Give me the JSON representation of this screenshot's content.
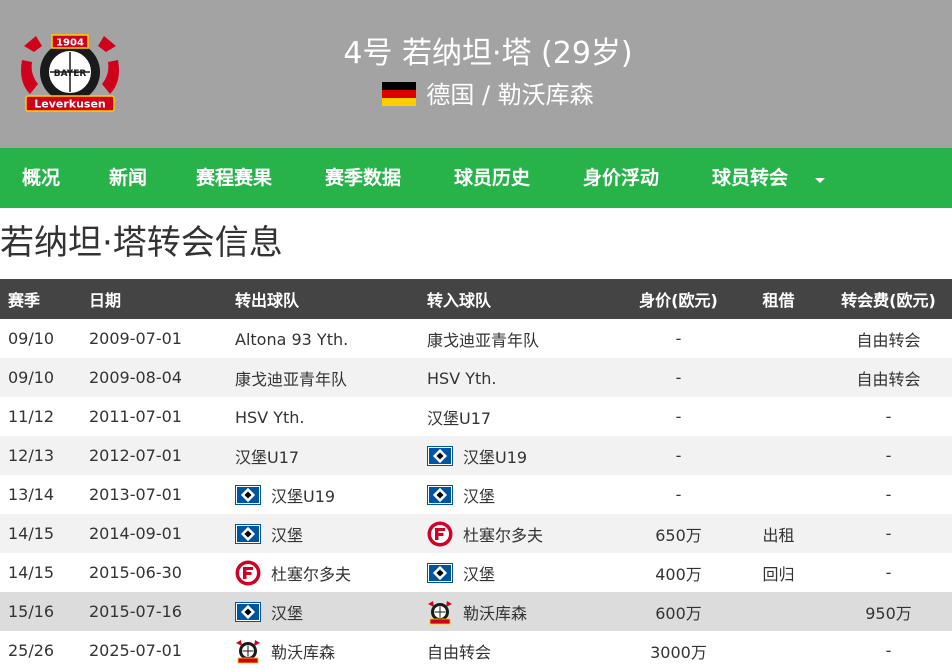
{
  "header": {
    "player_title": "4号 若纳坦·塔 (29岁)",
    "nationality_club": "德国 / 勒沃库森",
    "background_color": "#a3a3a3",
    "logo_text": {
      "year": "1904",
      "brand": "BAYER",
      "city": "Leverkusen"
    }
  },
  "nav": {
    "items": [
      "概况",
      "新闻",
      "赛程赛果",
      "赛季数据",
      "球员历史",
      "身价浮动",
      "球员转会"
    ],
    "color": "#28b34a"
  },
  "page_title": "若纳坦·塔转会信息",
  "table": {
    "headers": [
      "赛季",
      "日期",
      "转出球队",
      "转入球队",
      "身价(欧元)",
      "租借",
      "转会费(欧元)"
    ],
    "rows": [
      {
        "season": "09/10",
        "date": "2009-07-01",
        "from": "Altona 93 Yth.",
        "from_icon": "",
        "to": "康戈迪亚青年队",
        "to_icon": "",
        "value": "-",
        "loan": "",
        "fee": "自由转会"
      },
      {
        "season": "09/10",
        "date": "2009-08-04",
        "from": "康戈迪亚青年队",
        "from_icon": "",
        "to": "HSV Yth.",
        "to_icon": "",
        "value": "-",
        "loan": "",
        "fee": "自由转会"
      },
      {
        "season": "11/12",
        "date": "2011-07-01",
        "from": "HSV Yth.",
        "from_icon": "",
        "to": "汉堡U17",
        "to_icon": "",
        "value": "-",
        "loan": "",
        "fee": "-"
      },
      {
        "season": "12/13",
        "date": "2012-07-01",
        "from": "汉堡U17",
        "from_icon": "",
        "to": "汉堡U19",
        "to_icon": "hsv-crest-icon",
        "value": "-",
        "loan": "",
        "fee": "-"
      },
      {
        "season": "13/14",
        "date": "2013-07-01",
        "from": "汉堡U19",
        "from_icon": "hsv-crest-icon",
        "to": "汉堡",
        "to_icon": "hsv-crest-icon",
        "value": "-",
        "loan": "",
        "fee": "-"
      },
      {
        "season": "14/15",
        "date": "2014-09-01",
        "from": "汉堡",
        "from_icon": "hsv-crest-icon",
        "to": "杜塞尔多夫",
        "to_icon": "fortuna-crest-icon",
        "value": "650万",
        "loan": "出租",
        "fee": "-"
      },
      {
        "season": "14/15",
        "date": "2015-06-30",
        "from": "杜塞尔多夫",
        "from_icon": "fortuna-crest-icon",
        "to": "汉堡",
        "to_icon": "hsv-crest-icon",
        "value": "400万",
        "loan": "回归",
        "fee": "-"
      },
      {
        "season": "15/16",
        "date": "2015-07-16",
        "from": "汉堡",
        "from_icon": "hsv-crest-icon",
        "to": "勒沃库森",
        "to_icon": "leverkusen-crest-icon",
        "value": "600万",
        "loan": "",
        "fee": "950万",
        "highlight": true
      },
      {
        "season": "25/26",
        "date": "2025-07-01",
        "from": "勒沃库森",
        "from_icon": "leverkusen-crest-icon",
        "to": "自由转会",
        "to_icon": "",
        "value": "3000万",
        "loan": "",
        "fee": "-"
      }
    ]
  }
}
